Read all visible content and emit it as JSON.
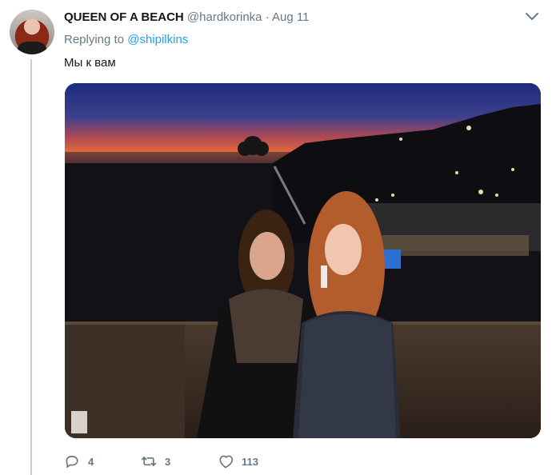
{
  "tweet": {
    "display_name": "QUEEN OF A BEACH",
    "handle": "@hardkorinka",
    "separator": "·",
    "date": "Aug 11",
    "replying_prefix": "Replying to",
    "replying_to": "@shipilkins",
    "text": "Мы к вам",
    "photo_description_icon": "photo",
    "counts": {
      "replies": "4",
      "retweets": "3",
      "likes": "113"
    }
  },
  "icons": {
    "more": "chevron-down-icon",
    "reply": "reply-icon",
    "retweet": "retweet-icon",
    "like": "heart-icon"
  },
  "colors": {
    "link": "#1da1f2",
    "muted": "#657786",
    "text": "#14171a",
    "thread_line": "#c4cfd6"
  }
}
